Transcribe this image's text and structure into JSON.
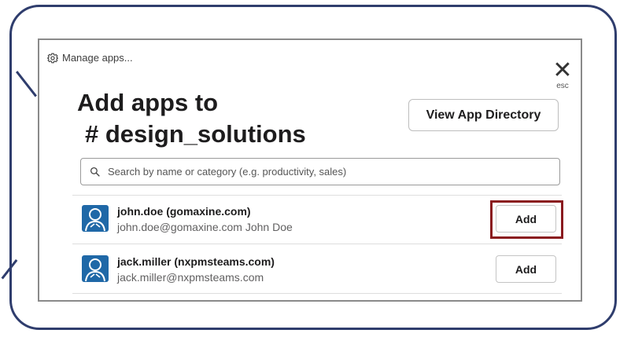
{
  "dialog": {
    "manage_apps": "Manage apps...",
    "close_glyph": "✕",
    "esc_label": "esc",
    "title_line1": "Add apps to",
    "title_line2": "# design_solutions",
    "view_directory_label": "View App Directory"
  },
  "search": {
    "placeholder": "Search by name or category (e.g. productivity, sales)"
  },
  "apps": [
    {
      "name": "john.doe (gomaxine.com)",
      "subtitle": "john.doe@gomaxine.com John Doe",
      "add_label": "Add",
      "highlighted": true
    },
    {
      "name": "jack.miller (nxpmsteams.com)",
      "subtitle": "jack.miller@nxpmsteams.com",
      "add_label": "Add",
      "highlighted": false
    }
  ],
  "colors": {
    "frame": "#2f3d6d",
    "highlight": "#8a1a1f",
    "avatar": "#1f68a7"
  },
  "icons": {
    "manage": "gear-icon",
    "search": "search-icon",
    "close": "close-icon",
    "avatar": "user-avatar-icon"
  }
}
